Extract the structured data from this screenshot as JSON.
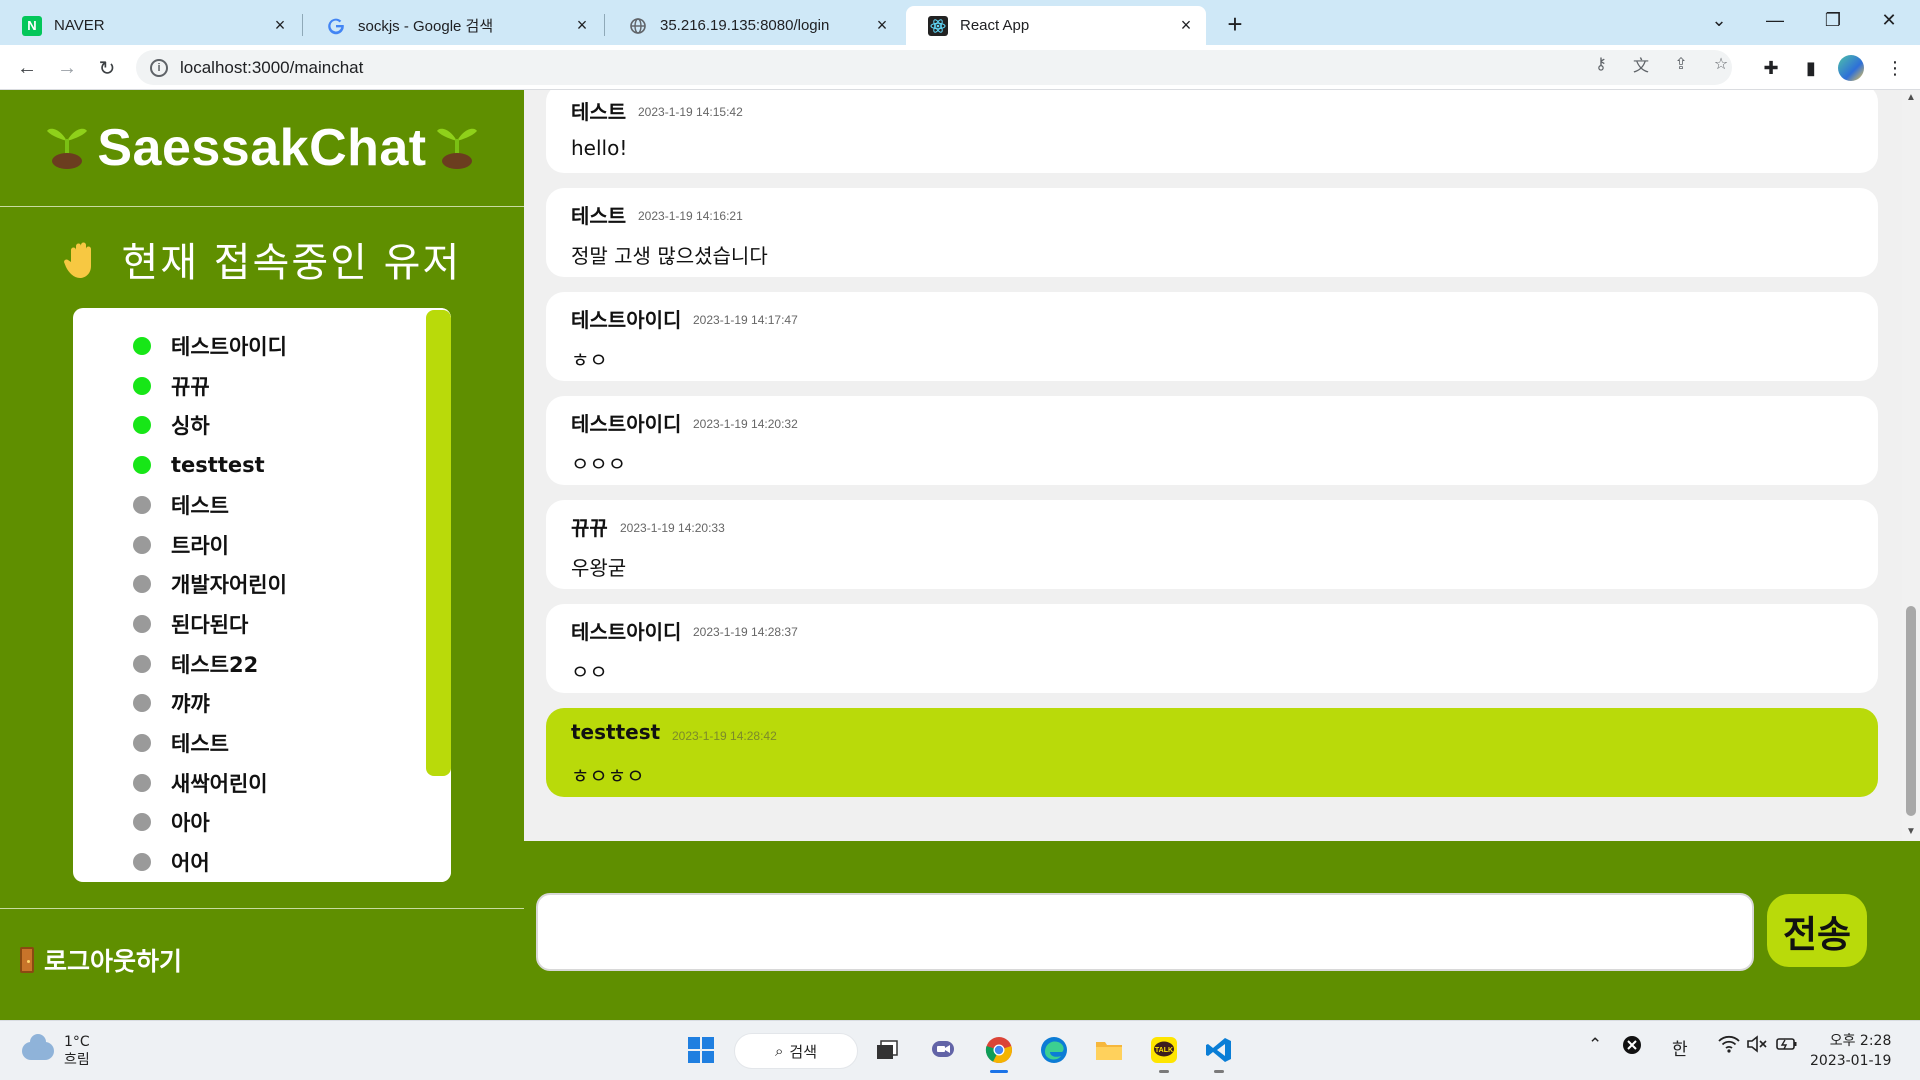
{
  "browser": {
    "tabs": [
      {
        "label": "NAVER",
        "icon": "naver-icon"
      },
      {
        "label": "sockjs - Google 검색",
        "icon": "google-icon"
      },
      {
        "label": "35.216.19.135:8080/login",
        "icon": "globe-icon"
      },
      {
        "label": "React App",
        "icon": "react-icon"
      }
    ],
    "active_tab": 3,
    "url": "localhost:3000/mainchat"
  },
  "app": {
    "brand": "SaessakChat",
    "online_title": "현재 접속중인 유저",
    "users": [
      {
        "name": "테스트아이디",
        "online": true
      },
      {
        "name": "뀨뀨",
        "online": true
      },
      {
        "name": "싱하",
        "online": true
      },
      {
        "name": "testtest",
        "online": true
      },
      {
        "name": "테스트",
        "online": false
      },
      {
        "name": "트라이",
        "online": false
      },
      {
        "name": "개발자어린이",
        "online": false
      },
      {
        "name": "된다된다",
        "online": false
      },
      {
        "name": "테스트22",
        "online": false
      },
      {
        "name": "꺄꺄",
        "online": false
      },
      {
        "name": "테스트",
        "online": false
      },
      {
        "name": "새싹어린이",
        "online": false
      },
      {
        "name": "아아",
        "online": false
      },
      {
        "name": "어어",
        "online": false
      }
    ],
    "logout_label": "로그아웃하기",
    "messages": [
      {
        "author": "테스트",
        "time": "2023-1-19 14:15:42",
        "text": "hello!",
        "mine": false
      },
      {
        "author": "테스트",
        "time": "2023-1-19 14:16:21",
        "text": "정말 고생 많으셨습니다",
        "mine": false
      },
      {
        "author": "테스트아이디",
        "time": "2023-1-19 14:17:47",
        "text": "ㅎㅇ",
        "mine": false
      },
      {
        "author": "테스트아이디",
        "time": "2023-1-19 14:20:32",
        "text": "ㅇㅇㅇ",
        "mine": false
      },
      {
        "author": "뀨뀨",
        "time": "2023-1-19 14:20:33",
        "text": "우왕굳",
        "mine": false
      },
      {
        "author": "테스트아이디",
        "time": "2023-1-19 14:28:37",
        "text": "ㅇㅇ",
        "mine": false
      },
      {
        "author": "testtest",
        "time": "2023-1-19 14:28:42",
        "text": "ㅎㅇㅎㅇ",
        "mine": true
      }
    ],
    "input_value": "",
    "send_label": "전송"
  },
  "taskbar": {
    "weather_temp": "1°C",
    "weather_desc": "흐림",
    "search_label": "검색",
    "ime": "한",
    "clock_time": "오후 2:28",
    "clock_date": "2023-01-19"
  },
  "colors": {
    "sidebar_green": "#5f8f00",
    "accent_lime": "#b9da0a",
    "online_dot": "#17e617",
    "offline_dot": "#9a9a9a"
  }
}
